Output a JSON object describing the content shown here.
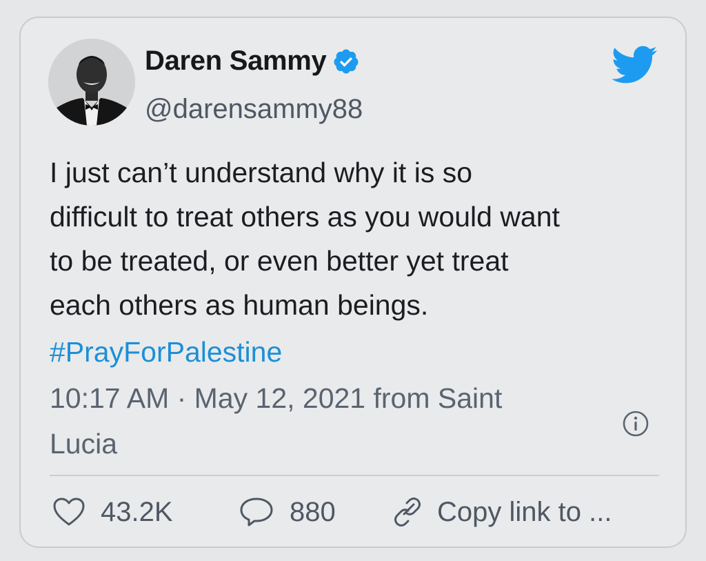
{
  "tweet": {
    "author": {
      "display_name": "Daren Sammy",
      "handle": "@darensammy88",
      "verified": true
    },
    "text": "I just can’t understand why it is so\ndifficult to treat others as you would want\nto be treated, or even better yet treat\neach others as human beings.",
    "hashtag": "#PrayForPalestine",
    "meta": "10:17 AM · May 12, 2021 from Saint\nLucia",
    "actions": {
      "likes": "43.2K",
      "replies": "880",
      "copy_link": "Copy link to ..."
    }
  },
  "icons": {
    "brand": "twitter-bird-icon",
    "verified": "verified-badge-icon",
    "info": "info-icon",
    "like": "heart-icon",
    "reply": "speech-bubble-icon",
    "link": "link-icon"
  },
  "colors": {
    "background": "#e6e7e9",
    "brand_blue": "#1d9bf0",
    "hashtag_blue": "#1c8fd6",
    "text_primary": "#1b1d20",
    "text_secondary": "#5a6470"
  }
}
